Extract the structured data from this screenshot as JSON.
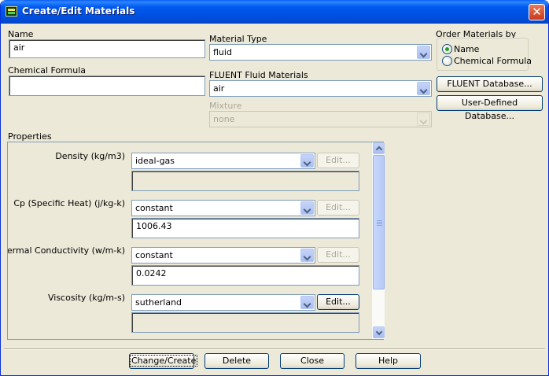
{
  "window": {
    "title": "Create/Edit Materials",
    "close_glyph": "✕"
  },
  "name": {
    "label": "Name",
    "value": "air"
  },
  "chemical_formula": {
    "label": "Chemical Formula",
    "value": ""
  },
  "material_type": {
    "label": "Material Type",
    "value": "fluid"
  },
  "fluent_fluid_materials": {
    "label": "FLUENT Fluid Materials",
    "value": "air"
  },
  "mixture": {
    "label": "Mixture",
    "value": "none"
  },
  "order_by": {
    "label": "Order Materials by",
    "options": [
      {
        "label": "Name",
        "checked": true
      },
      {
        "label": "Chemical Formula",
        "checked": false
      }
    ]
  },
  "side_buttons": {
    "fluent_database": "FLUENT Database...",
    "user_defined_database": "User-Defined Database..."
  },
  "properties": {
    "label": "Properties",
    "rows": [
      {
        "label": "Density (kg/m3)",
        "method": "ideal-gas",
        "edit": "Edit...",
        "edit_enabled": false,
        "value": ""
      },
      {
        "label": "Cp (Specific Heat) (j/kg-k)",
        "method": "constant",
        "edit": "Edit...",
        "edit_enabled": false,
        "value": "1006.43"
      },
      {
        "label": "Thermal Conductivity (w/m-k)",
        "method": "constant",
        "edit": "Edit...",
        "edit_enabled": false,
        "value": "0.0242"
      },
      {
        "label": "Viscosity (kg/m-s)",
        "method": "sutherland",
        "edit": "Edit...",
        "edit_enabled": true,
        "value": ""
      }
    ]
  },
  "footer": {
    "change_create": "Change/Create",
    "delete": "Delete",
    "close": "Close",
    "help": "Help"
  },
  "icons": [
    "app-icon",
    "close-icon",
    "chevron-down-icon",
    "scroll-up-icon",
    "scroll-down-icon"
  ]
}
